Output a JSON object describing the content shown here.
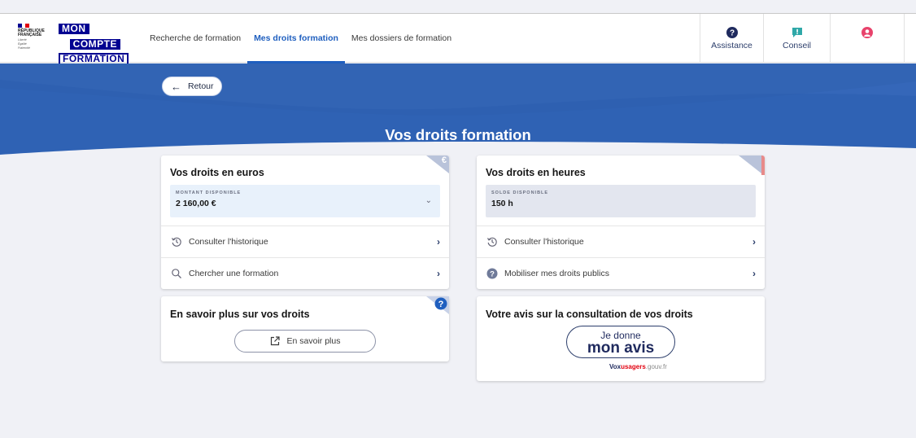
{
  "brand": {
    "marianne_text": [
      "RÉPUBLIQUE",
      "FRANÇAISE"
    ],
    "marianne_motto": [
      "Liberté",
      "Égalité",
      "Fraternité"
    ],
    "logo_lines": [
      "MON",
      "COMPTE",
      "FORMATION"
    ]
  },
  "nav": {
    "items": [
      {
        "label": "Recherche de formation",
        "active": false
      },
      {
        "label": "Mes droits formation",
        "active": true
      },
      {
        "label": "Mes dossiers de formation",
        "active": false
      }
    ]
  },
  "header_buttons": {
    "assistance": {
      "label": "Assistance",
      "icon": "question-circle-icon"
    },
    "conseil": {
      "label": "Conseil",
      "icon": "chat-alert-icon"
    },
    "account": {
      "label": "",
      "icon": "user-account-icon"
    }
  },
  "banner": {
    "back_label": "Retour",
    "title": "Vos droits formation"
  },
  "card_euros": {
    "title": "Vos droits en euros",
    "corner_symbol": "€",
    "amount_label": "MONTANT DISPONIBLE",
    "amount_value": "2 160,00 €",
    "rows": [
      {
        "label": "Consulter l'historique",
        "icon": "history-icon"
      },
      {
        "label": "Chercher une formation",
        "icon": "search-icon"
      }
    ]
  },
  "card_heures": {
    "title": "Vos droits en heures",
    "balance_label": "SOLDE DISPONIBLE",
    "balance_value": "150 h",
    "rows": [
      {
        "label": "Consulter l'historique",
        "icon": "history-icon"
      },
      {
        "label": "Mobiliser mes droits publics",
        "icon": "question-circle-icon"
      }
    ]
  },
  "card_info": {
    "title": "En savoir plus sur vos droits",
    "button_label": "En savoir plus"
  },
  "card_avis": {
    "title": "Votre avis sur la consultation de vos droits",
    "button_line1": "Je donne",
    "button_line2": "mon avis",
    "vox_brand_1": "Vox",
    "vox_brand_2": "usagers",
    "vox_brand_3": ".gouv.fr"
  },
  "colors": {
    "primary_blue": "#1f5fbf",
    "banner_blue": "#2f62b4",
    "marianne_blue": "#000091",
    "marianne_red": "#e1000f"
  }
}
